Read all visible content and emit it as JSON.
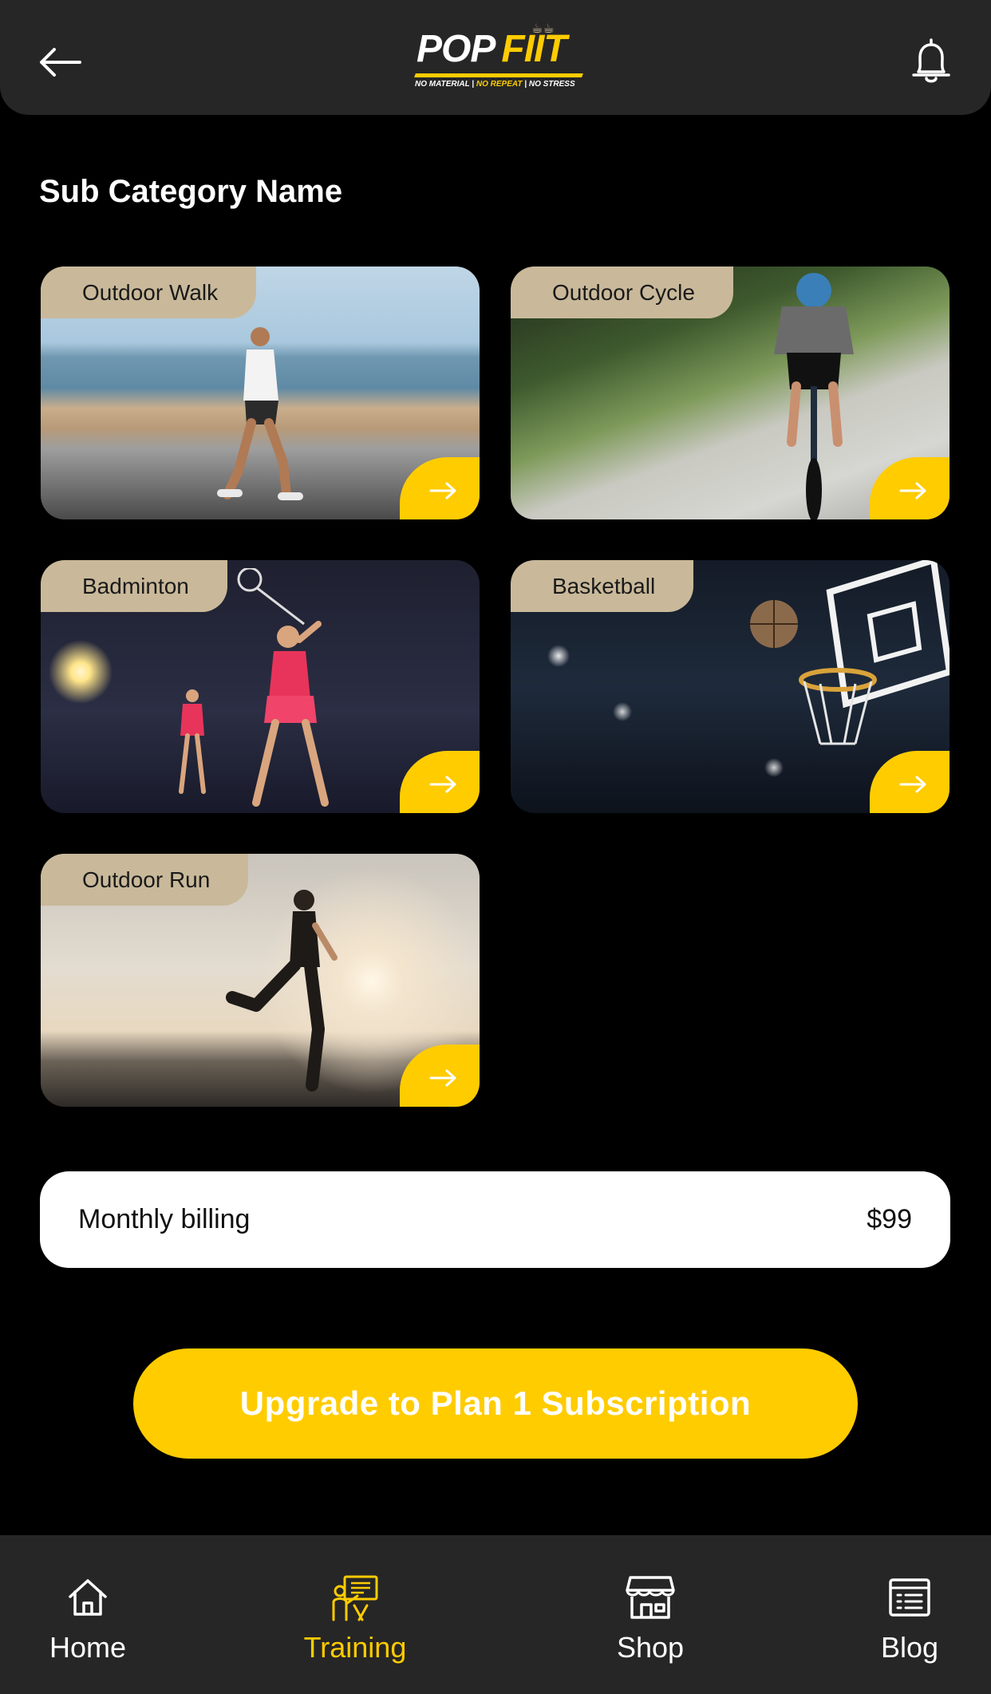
{
  "header": {
    "back_icon": "arrow-left-icon",
    "notification_icon": "bell-icon",
    "logo": {
      "pop": "POP",
      "fiit": "FIIT",
      "tagline_part1": "NO MATERIAL |",
      "tagline_part2": "NO REPEAT",
      "tagline_part3": "| NO STRESS"
    }
  },
  "section": {
    "title": "Sub Category Name"
  },
  "categories": [
    {
      "label": "Outdoor Walk",
      "action_icon": "arrow-right-icon"
    },
    {
      "label": "Outdoor Cycle",
      "action_icon": "arrow-right-icon"
    },
    {
      "label": "Badminton",
      "action_icon": "arrow-right-icon"
    },
    {
      "label": "Basketball",
      "action_icon": "arrow-right-icon"
    },
    {
      "label": "Outdoor Run",
      "action_icon": "arrow-right-icon"
    }
  ],
  "billing": {
    "label": "Monthly billing",
    "price": "$99"
  },
  "cta": {
    "label": "Upgrade to Plan 1 Subscription"
  },
  "tabbar": {
    "items": [
      {
        "label": "Home",
        "icon": "home-icon",
        "active": false
      },
      {
        "label": "Training",
        "icon": "training-icon",
        "active": true
      },
      {
        "label": "Shop",
        "icon": "shop-icon",
        "active": false
      },
      {
        "label": "Blog",
        "icon": "blog-icon",
        "active": false
      }
    ]
  },
  "colors": {
    "accent": "#ffcc00",
    "background": "#000000",
    "surface": "#262626",
    "card_label_bg": "#c9b99a"
  }
}
